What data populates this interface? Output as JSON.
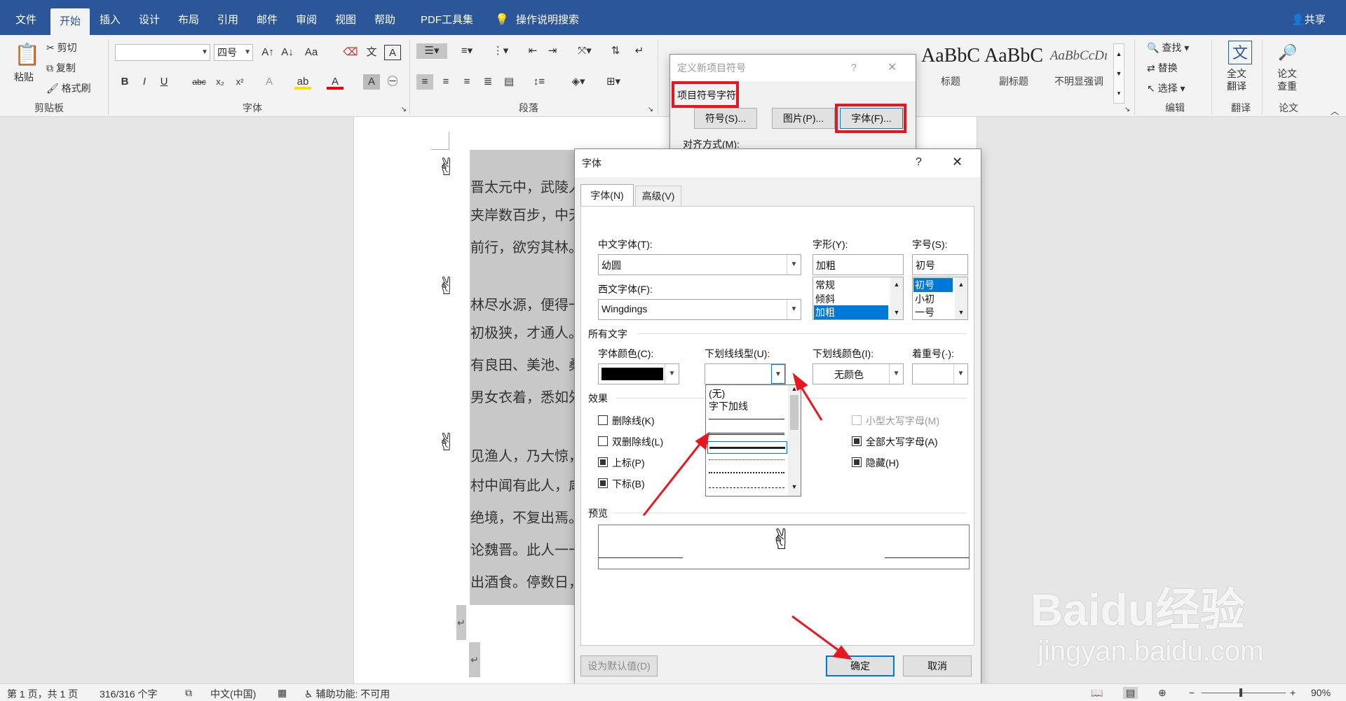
{
  "tabs": [
    "文件",
    "开始",
    "插入",
    "设计",
    "布局",
    "引用",
    "邮件",
    "审阅",
    "视图",
    "帮助",
    "PDF工具集"
  ],
  "tell_me": "操作说明搜索",
  "share": "共享",
  "clipboard": {
    "paste": "粘贴",
    "cut": "剪切",
    "copy": "复制",
    "format_painter": "格式刷",
    "label": "剪贴板"
  },
  "font_group": {
    "font_name": "",
    "font_size": "四号",
    "label": "字体"
  },
  "paragraph_group": {
    "label": "段落"
  },
  "styles": [
    {
      "sample": "AaBbC",
      "name": "标题"
    },
    {
      "sample": "AaBbC",
      "name": "副标题"
    },
    {
      "sample": "AaBbCcDı",
      "name": "不明显强调"
    }
  ],
  "editing": {
    "find": "查找",
    "replace": "替换",
    "select": "选择",
    "label": "编辑"
  },
  "translate": {
    "full": "全文\n翻译",
    "label": "翻译"
  },
  "paper": {
    "check": "论文\n查重",
    "label": "论文"
  },
  "document": {
    "lines": [
      "晋太元中，武陵人",
      "夹岸数百步，中无",
      "前行，欲穷其林。",
      "林尽水源，便得一",
      "初极狭，才通人。",
      "有良田、美池、桑",
      "男女衣着，悉如外",
      "见渔人，乃大惊，",
      "村中闻有此人，咸",
      "绝境，不复出焉。",
      "论魏晋。此人一一",
      "出酒食。停数日，"
    ]
  },
  "bullet_dialog": {
    "title": "定义新项目符号",
    "section": "项目符号字符",
    "symbol_btn": "符号(S)...",
    "picture_btn": "图片(P)...",
    "font_btn": "字体(F)...",
    "align": "对齐方式(M):",
    "help": "?",
    "close": "✕"
  },
  "font_dialog": {
    "title": "字体",
    "help": "?",
    "close": "✕",
    "tabs": [
      "字体(N)",
      "高级(V)"
    ],
    "cn_font_label": "中文字体(T):",
    "cn_font_value": "幼圆",
    "west_font_label": "西文字体(F):",
    "west_font_value": "Wingdings",
    "style_label": "字形(Y):",
    "style_value": "加粗",
    "style_options": [
      "常规",
      "倾斜",
      "加粗"
    ],
    "size_label": "字号(S):",
    "size_value": "初号",
    "size_options": [
      "初号",
      "小初",
      "一号"
    ],
    "all_text": "所有文字",
    "font_color_label": "字体颜色(C):",
    "underline_label": "下划线线型(U):",
    "underline_color_label": "下划线颜色(I):",
    "underline_color_value": "无颜色",
    "emphasis_label": "着重号(·):",
    "underline_options": [
      "(无)",
      "字下加线"
    ],
    "effects": "效果",
    "effects_left": [
      {
        "label": "删除线(K)",
        "checked": false
      },
      {
        "label": "双删除线(L)",
        "checked": false
      },
      {
        "label": "上标(P)",
        "checked": true
      },
      {
        "label": "下标(B)",
        "checked": true
      }
    ],
    "effects_right": [
      {
        "label": "小型大写字母(M)",
        "checked": false,
        "disabled": true
      },
      {
        "label": "全部大写字母(A)",
        "checked": true
      },
      {
        "label": "隐藏(H)",
        "checked": true
      }
    ],
    "preview": "预览",
    "default_btn": "设为默认值(D)",
    "ok": "确定",
    "cancel": "取消"
  },
  "status": {
    "page": "第 1 页，共 1 页",
    "words": "316/316 个字",
    "lang": "中文(中国)",
    "access": "辅助功能: 不可用",
    "zoom": "90%"
  },
  "watermark": {
    "brand": "Baidu经验",
    "url": "jingyan.baidu.com"
  }
}
